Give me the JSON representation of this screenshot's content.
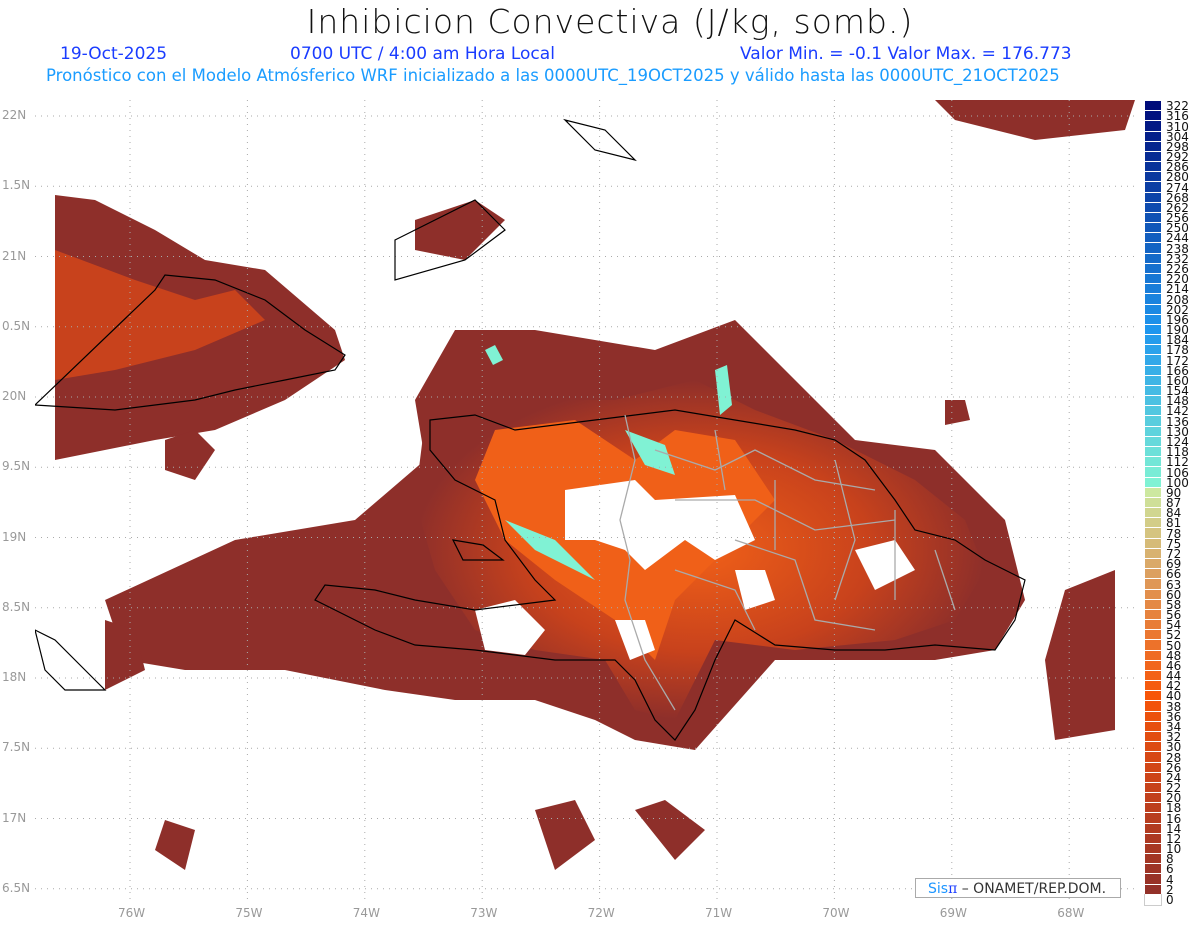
{
  "header": {
    "title": "Inhibicion Convectiva (J/kg, somb.)",
    "date": "19-Oct-2025",
    "time": "0700 UTC / 4:00 am Hora Local",
    "minmax": "Valor Min. = -0.1  Valor Max. = 176.773",
    "subtitle": "Pronóstico con el Modelo Atmósferico WRF inicializado a las 0000UTC_19OCT2025 y válido hasta las  0000UTC_21OCT2025"
  },
  "axes": {
    "lon_labels": [
      "76W",
      "75W",
      "74W",
      "73W",
      "72W",
      "71W",
      "70W",
      "69W",
      "68W"
    ],
    "lon_values": [
      -76,
      -75,
      -74,
      -73,
      -72,
      -71,
      -70,
      -69,
      -68
    ],
    "lat_labels": [
      "22N",
      "1.5N",
      "21N",
      "0.5N",
      "20N",
      "9.5N",
      "19N",
      "8.5N",
      "18N",
      "7.5N",
      "17N",
      "6.5N"
    ],
    "lat_values": [
      22,
      21.5,
      21,
      20.5,
      20,
      19.5,
      19,
      18.5,
      18,
      17.5,
      17,
      16.5
    ]
  },
  "colorbar": {
    "levels": [
      "0",
      "2",
      "4",
      "6",
      "8",
      "10",
      "12",
      "14",
      "16",
      "18",
      "20",
      "22",
      "24",
      "26",
      "28",
      "30",
      "32",
      "34",
      "36",
      "38",
      "40",
      "42",
      "44",
      "46",
      "48",
      "50",
      "52",
      "54",
      "56",
      "58",
      "60",
      "63",
      "66",
      "69",
      "72",
      "75",
      "78",
      "81",
      "84",
      "87",
      "90",
      "100",
      "106",
      "112",
      "118",
      "124",
      "130",
      "136",
      "142",
      "148",
      "154",
      "160",
      "166",
      "172",
      "178",
      "184",
      "190",
      "196",
      "202",
      "208",
      "214",
      "220",
      "226",
      "232",
      "238",
      "244",
      "250",
      "256",
      "262",
      "268",
      "274",
      "280",
      "286",
      "292",
      "298",
      "304",
      "310",
      "316",
      "322"
    ],
    "colors": {
      "zero": "#ffffff",
      "low": "#8e2f2a",
      "mid": "#c2401c",
      "orange": "#f75508",
      "tan": "#dca060",
      "green": "#cde8a0",
      "cyan": "#80f2d4",
      "sky": "#1e96ee",
      "navy": "#000c7a"
    }
  },
  "logo": {
    "brand_a": "Sis",
    "brand_b": "π",
    "org": " –  ONAMET/REP.DOM."
  }
}
